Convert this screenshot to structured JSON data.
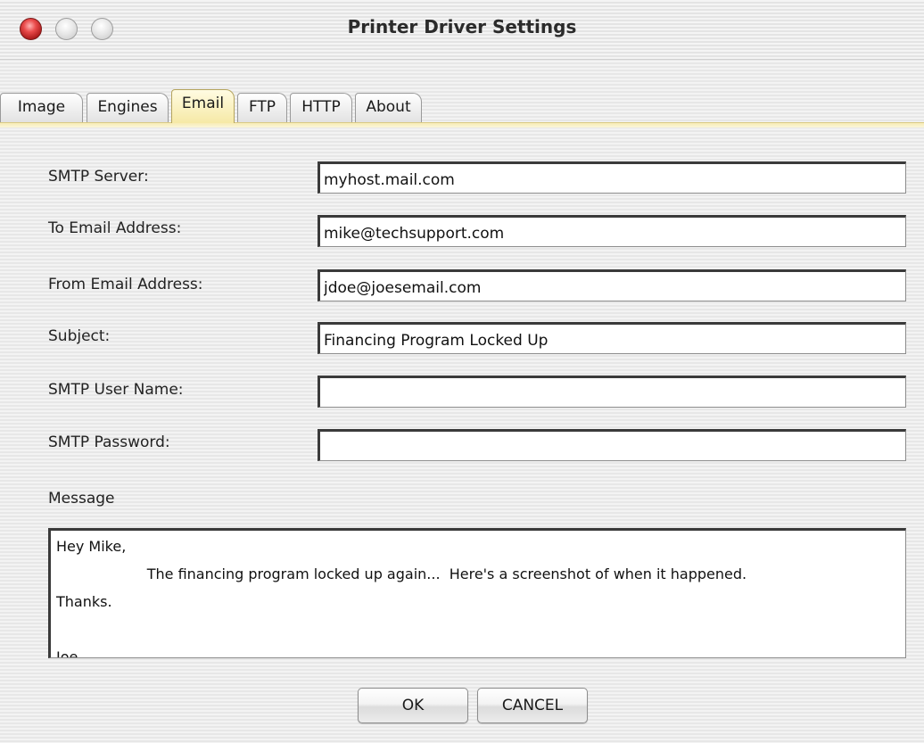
{
  "window": {
    "title": "Printer Driver Settings"
  },
  "tabs": [
    {
      "label": "Image",
      "selected": false
    },
    {
      "label": "Engines",
      "selected": false
    },
    {
      "label": "Email",
      "selected": true
    },
    {
      "label": "FTP",
      "selected": false
    },
    {
      "label": "HTTP",
      "selected": false
    },
    {
      "label": "About",
      "selected": false
    }
  ],
  "form": {
    "smtp_server": {
      "label": "SMTP Server:",
      "value": "myhost.mail.com"
    },
    "to_email": {
      "label": "To Email Address:",
      "value": "mike@techsupport.com"
    },
    "from_email": {
      "label": "From Email Address:",
      "value": "jdoe@joesemail.com"
    },
    "subject": {
      "label": "Subject:",
      "value": "Financing Program Locked Up"
    },
    "smtp_user": {
      "label": "SMTP User Name:",
      "value": ""
    },
    "smtp_password": {
      "label": "SMTP Password:",
      "value": ""
    },
    "message": {
      "label": "Message",
      "value": "Hey Mike,\n                    The financing program locked up again...  Here's a screenshot of when it happened.\nThanks.\n\nJoe"
    }
  },
  "buttons": {
    "ok_label": "OK",
    "cancel_label": "CANCEL"
  },
  "colors": {
    "close_button": "#e94a4a",
    "selected_tab": "#f6e9a6"
  }
}
